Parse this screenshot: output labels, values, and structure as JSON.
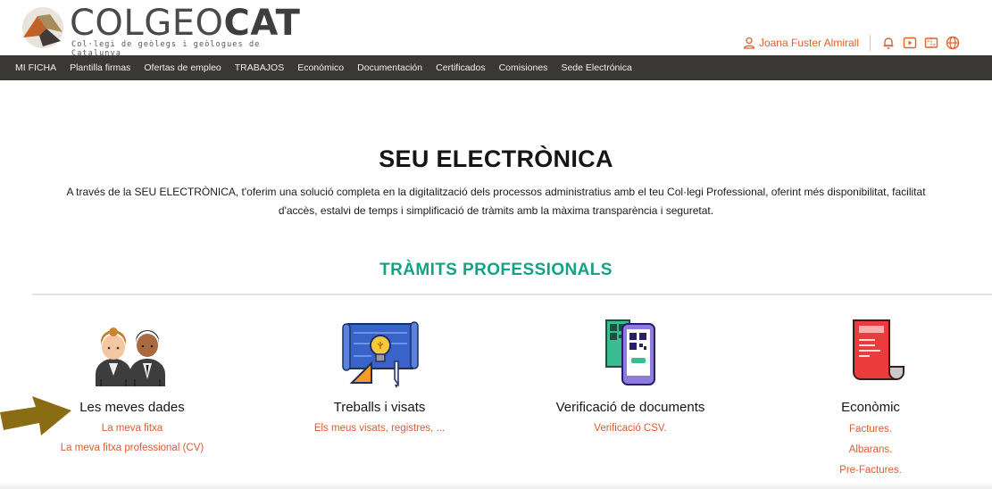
{
  "brand": {
    "logo_first": "COL",
    "logo_second": "GEO",
    "logo_third": "CAT",
    "subtitle": "Col·legi de geòlegs i geòlogues de Catalunya"
  },
  "header": {
    "user_name": "Joana Fuster Almirall",
    "icons": [
      "bell-icon",
      "video-icon",
      "ticket-icon",
      "globe-icon"
    ]
  },
  "nav": {
    "items": [
      "MI FICHA",
      "Plantilla firmas",
      "Ofertas de empleo",
      "TRABAJOS",
      "Económico",
      "Documentación",
      "Certificados",
      "Comisiones",
      "Sede Electrónica"
    ]
  },
  "main": {
    "title": "SEU ELECTRÒNICA",
    "intro_line1": "A través de la SEU ELECTRÒNICA, t'oferim una solució completa en la digitalització dels processos administratius amb el teu Col·legi Professional, oferint més disponibilitat, facilitat",
    "intro_line2": "d'accès, estalvi de temps i simplificació de tràmits amb la màxima transparència i seguretat.",
    "section_title": "TRÀMITS PROFESSIONALS"
  },
  "cards": [
    {
      "title": "Les meves dades",
      "links": [
        "La meva fitxa",
        "La meva fitxa professional (CV)"
      ]
    },
    {
      "title": "Treballs i visats",
      "links": [
        "Els meus visats, registres, ..."
      ]
    },
    {
      "title": "Verificació de documents",
      "links": [
        "Verificació CSV."
      ]
    },
    {
      "title": "Econòmic",
      "links": [
        "Factures.",
        "Albarans.",
        "Pre-Factures."
      ]
    }
  ],
  "colors": {
    "accent_orange": "#e05a30",
    "accent_green": "#17a184",
    "navbar_bg": "#3a3835",
    "arrow": "#8a6d12"
  }
}
